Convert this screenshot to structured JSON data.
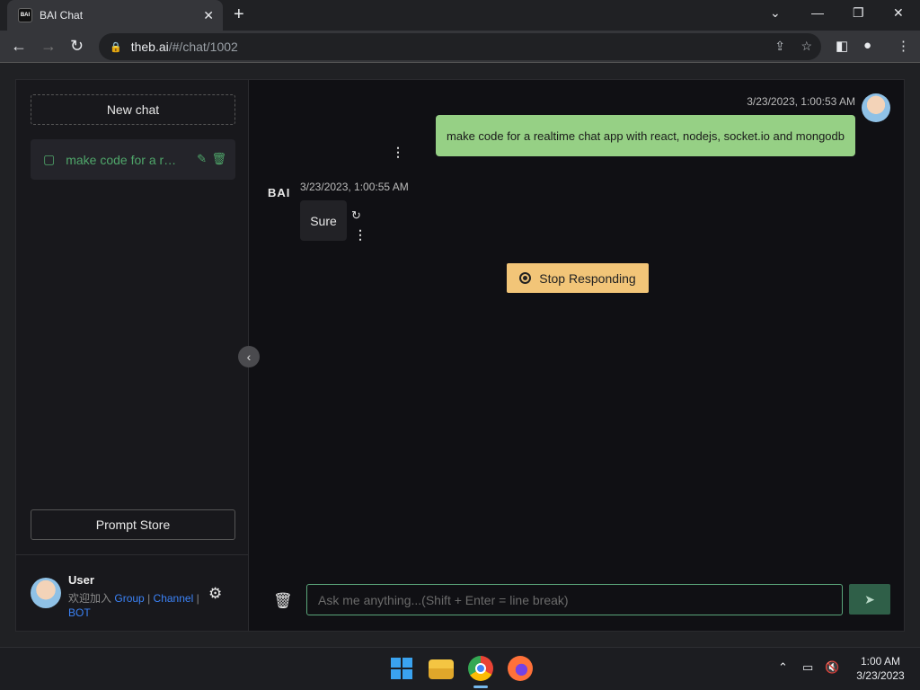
{
  "browser": {
    "tab_title": "BAI Chat",
    "favicon_text": "BAI",
    "url_host": "theb.ai",
    "url_path": "/#/chat/1002"
  },
  "sidebar": {
    "new_chat_label": "New chat",
    "history": [
      {
        "label": "make code for a realtime chat app with react, nodejs, socket.io and mongodb"
      }
    ],
    "prompt_store_label": "Prompt Store",
    "user": {
      "name": "User",
      "join_prefix": "欢迎加入",
      "links": [
        "Group",
        "Channel",
        "BOT"
      ],
      "separator": "|"
    }
  },
  "chat": {
    "messages": [
      {
        "role": "user",
        "timestamp": "3/23/2023, 1:00:53 AM",
        "text": "make code for a realtime chat app with react, nodejs, socket.io and mongodb"
      },
      {
        "role": "bot",
        "logo": "BAI",
        "timestamp": "3/23/2023, 1:00:55 AM",
        "text": "Sure"
      }
    ],
    "stop_label": "Stop Responding",
    "input_placeholder": "Ask me anything...(Shift + Enter = line break)"
  },
  "taskbar": {
    "time": "1:00 AM",
    "date": "3/23/2023"
  },
  "colors": {
    "accent_green": "#4fa66a",
    "user_bubble": "#96d085",
    "stop_button": "#f2c578",
    "link_blue": "#3b82f6"
  }
}
